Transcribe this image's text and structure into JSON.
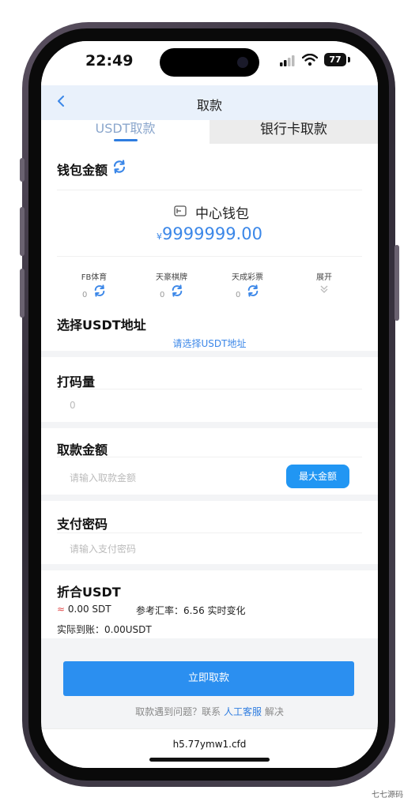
{
  "status_bar": {
    "time": "22:49",
    "battery": "77"
  },
  "nav": {
    "title": "取款"
  },
  "tabs": [
    {
      "label": "USDT取款"
    },
    {
      "label": "银行卡取款"
    }
  ],
  "wallet": {
    "section_title": "钱包金额",
    "center_label": "中心钱包",
    "currency_symbol": "¥",
    "amount": "9999999.00",
    "venues": [
      {
        "name": "FB体育",
        "balance": "0"
      },
      {
        "name": "天豪棋牌",
        "balance": "0"
      },
      {
        "name": "天成彩票",
        "balance": "0"
      }
    ],
    "expand_label": "展开"
  },
  "usdt_address": {
    "title": "选择USDT地址",
    "placeholder": "请选择USDT地址"
  },
  "turnover": {
    "title": "打码量",
    "value": "0"
  },
  "amount": {
    "title": "取款金额",
    "placeholder": "请输入取款金额",
    "max_button": "最大金额"
  },
  "password": {
    "title": "支付密码",
    "placeholder": "请输入支付密码"
  },
  "convert": {
    "title": "折合USDT",
    "approx_symbol": "≈",
    "approx_value": "0.00 SDT",
    "rate_label": "参考汇率：6.56 实时变化",
    "actual_label": "实际到账：0.00USDT"
  },
  "submit_label": "立即取款",
  "help": {
    "prefix": "取款遇到问题？联系",
    "link": "人工客服",
    "suffix": "解决"
  },
  "browser": {
    "url": "h5.77ymw1.cfd"
  },
  "watermark": "七七源码",
  "colors": {
    "accent": "#2b8ff0",
    "amount": "#3b87e8",
    "nav_bg": "#e9f1fb"
  }
}
